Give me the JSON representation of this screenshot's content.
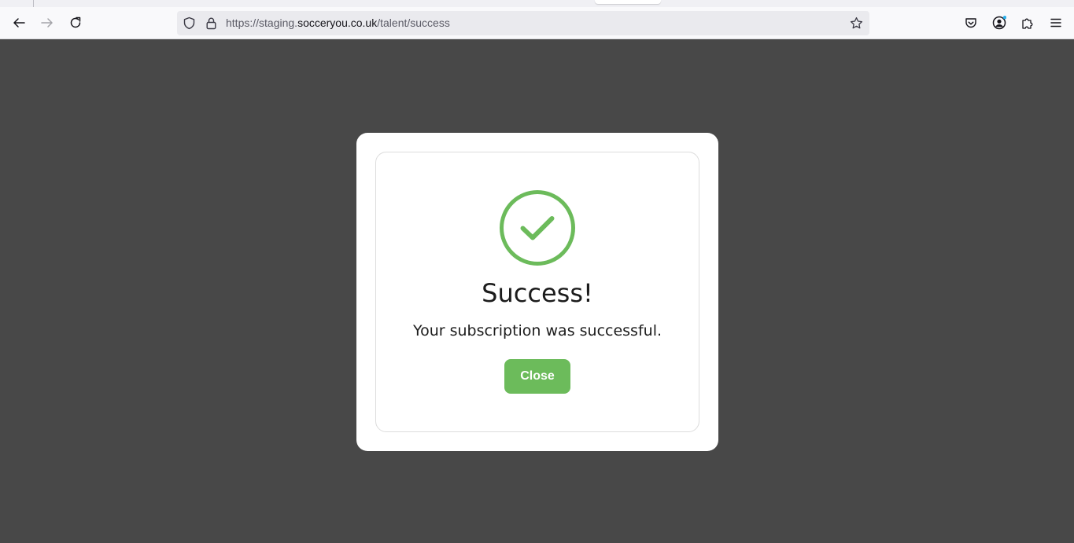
{
  "browser": {
    "url_prefix": "https://staging.",
    "url_host": "socceryou.co.uk",
    "url_path": "/talent/success",
    "icons": {
      "back": "arrow-left-icon",
      "forward": "arrow-right-icon",
      "reload": "reload-icon",
      "tracking_protection": "shield-icon",
      "security": "lock-icon",
      "bookmark": "star-icon",
      "pocket": "pocket-icon",
      "account": "account-icon",
      "extensions": "puzzle-icon",
      "menu": "hamburger-menu-icon"
    },
    "colors": {
      "toolbar_bg": "#f9f9fb",
      "urlbar_bg": "#eaeaee",
      "account_badge": "#2bb1ed"
    }
  },
  "page": {
    "backdrop_color": "#484848"
  },
  "modal": {
    "icon": "check-circle-icon",
    "title": "Success!",
    "message": "Your subscription was successful.",
    "close_label": "Close",
    "colors": {
      "accent": "#6cbb5b",
      "text": "#1c1c1c"
    }
  }
}
